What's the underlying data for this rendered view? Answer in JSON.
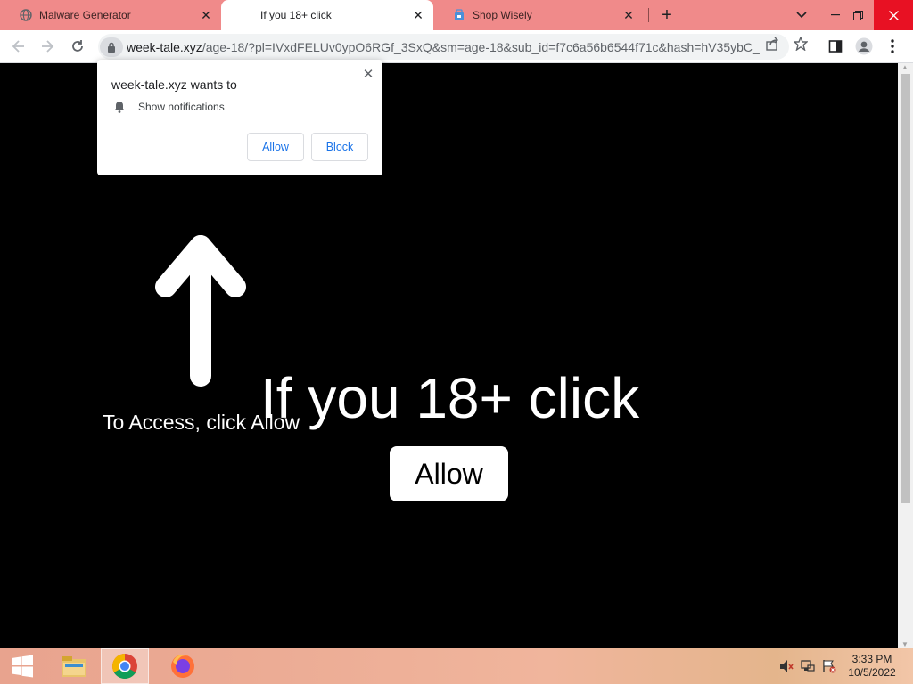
{
  "browser": {
    "tabs": [
      {
        "title": "Malware Generator",
        "favicon": "globe-icon",
        "active": false
      },
      {
        "title": "If you 18+ click",
        "favicon": "",
        "active": true
      },
      {
        "title": "Shop Wisely",
        "favicon": "shop-icon",
        "active": false
      }
    ],
    "url_host": "week-tale.xyz",
    "url_path": "/age-18/?pl=IVxdFELUv0ypO6RGf_3SxQ&sm=age-18&sub_id=f7c6a56b6544f71c&hash=hV35ybC_..."
  },
  "permission_popup": {
    "title": "week-tale.xyz wants to",
    "permission": "Show notifications",
    "allow_label": "Allow",
    "block_label": "Block"
  },
  "page": {
    "access_text": "To Access, click Allow",
    "headline": "If you 18+ click",
    "allow_label": "Allow"
  },
  "taskbar": {
    "time": "3:33 PM",
    "date": "10/5/2022"
  },
  "colors": {
    "tabbar_bg": "#f08a8a",
    "page_bg": "#000000",
    "link_blue": "#1a73e8"
  }
}
